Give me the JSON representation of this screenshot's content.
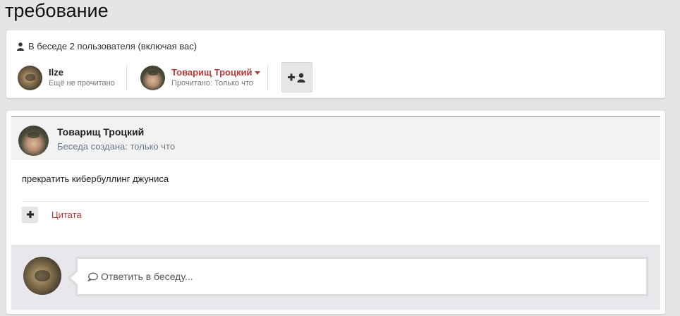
{
  "page": {
    "title": "требование"
  },
  "participants": {
    "header": "В беседе 2 пользователя (включая вас)",
    "users": [
      {
        "name": "Ilze",
        "status": "Ещё не прочитано",
        "avatar": "moth-avatar"
      },
      {
        "name": "Товарищ Троцкий",
        "status": "Прочитано: Только что",
        "avatar": "trotsky-avatar"
      }
    ],
    "add_user_icons": [
      "plus-icon",
      "user-icon"
    ]
  },
  "post": {
    "author": "Товарищ Троцкий",
    "meta": "Беседа создана: только что",
    "body": "прекратить кибербуллинг джуниса",
    "multiquote_icon": "plus-icon",
    "quote_label": "Цитата"
  },
  "reply": {
    "placeholder": "Ответить в беседу...",
    "icon": "speech-bubble-icon"
  },
  "colors": {
    "accent": "#b53a3a",
    "meta_text": "#6b7a8c",
    "background": "#e5e5e5"
  }
}
